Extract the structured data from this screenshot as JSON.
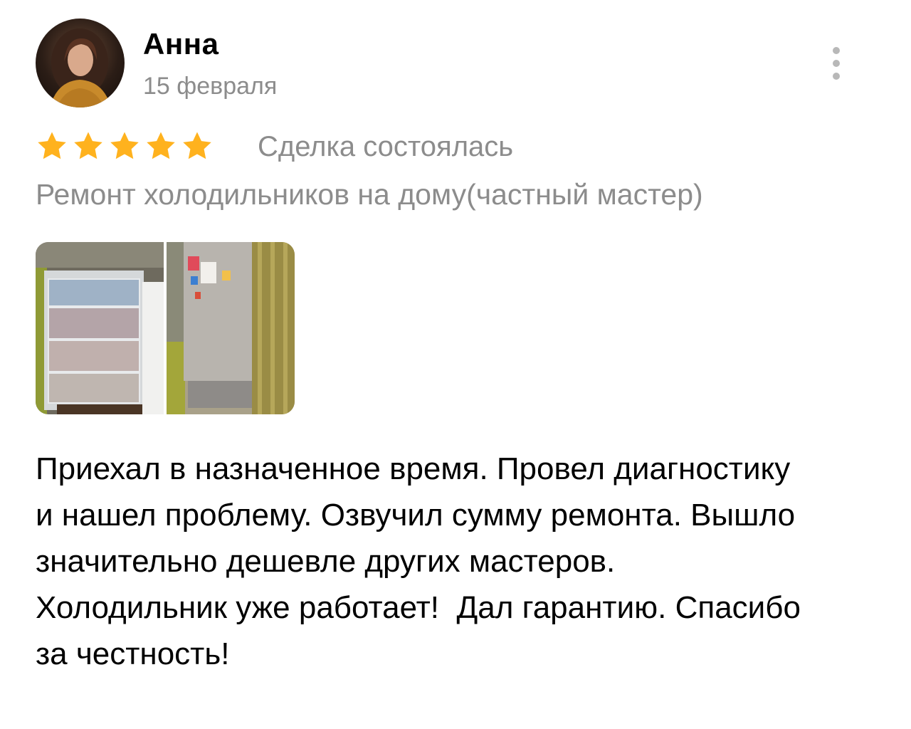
{
  "review": {
    "author": {
      "name": "Анна",
      "avatar_icon": "user-photo"
    },
    "date": "15 февраля",
    "more_icon": "more-vertical-icon",
    "rating": {
      "value": 5,
      "max": 5,
      "star_color": "#FFB21E"
    },
    "deal_status": "Сделка состоялась",
    "service": "Ремонт холодильников на дому(частный мастер)",
    "photos": [
      {
        "subject": "open-freezer-drawers"
      },
      {
        "subject": "steel-fridge-with-magnets"
      }
    ],
    "text_lines": [
      "Приехал в назначенное время. Провел диагностику",
      "и нашел проблему. Озвучил сумму ремонта. Вышло",
      "значительно дешевле других мастеров.",
      "Холодильник уже работает!  Дал гарантию. Спасибо",
      "за честность!"
    ]
  }
}
